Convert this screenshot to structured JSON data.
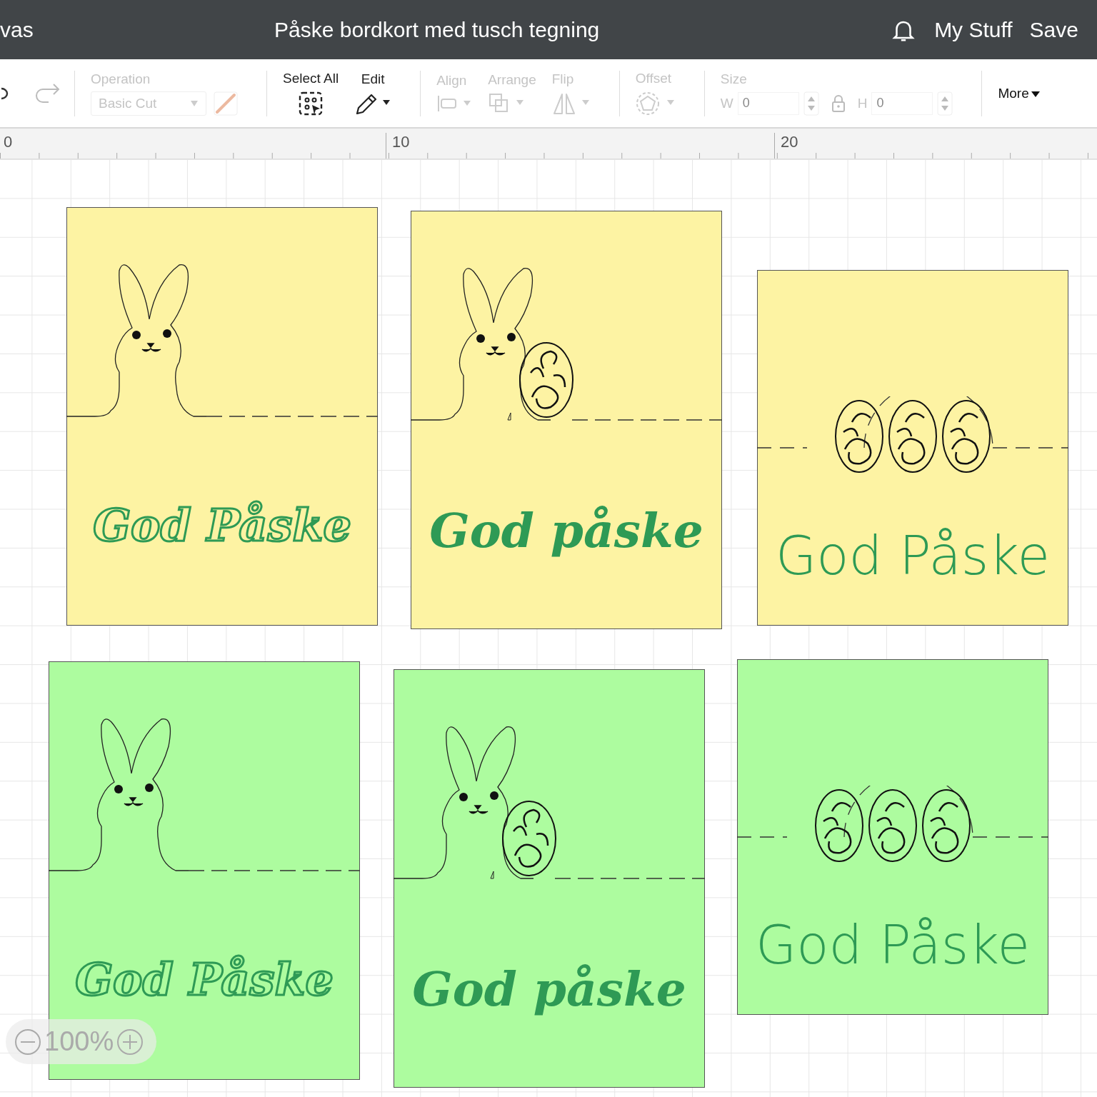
{
  "top_bar": {
    "left_text": "vas",
    "title": "Påske bordkort med tusch tegning",
    "links": [
      "My Stuff",
      "Save"
    ]
  },
  "toolbar": {
    "groups": [
      {
        "kind": "operation",
        "label": "Operation",
        "value": "Basic Cut",
        "disabled": true
      },
      {
        "kind": "select_all",
        "label": "Select All",
        "disabled": false
      },
      {
        "kind": "edit",
        "label": "Edit",
        "disabled": false
      },
      {
        "kind": "align",
        "label": "Align",
        "disabled": true
      },
      {
        "kind": "arrange",
        "label": "Arrange",
        "disabled": true
      },
      {
        "kind": "flip",
        "label": "Flip",
        "disabled": true
      },
      {
        "kind": "offset",
        "label": "Offset",
        "disabled": true
      },
      {
        "kind": "size",
        "label": "Size",
        "w_label": "W",
        "w_value": "0",
        "h_label": "H",
        "h_value": "0",
        "disabled": true
      },
      {
        "kind": "more",
        "label": "More",
        "disabled": false
      }
    ]
  },
  "ruler": {
    "labels": [
      "0",
      "10",
      "20"
    ]
  },
  "cards": [
    {
      "color": "#fdf3a3",
      "kind": "bunny",
      "greeting": "God Påske"
    },
    {
      "color": "#fdf3a3",
      "kind": "bunny_egg",
      "greeting": "God påske"
    },
    {
      "color": "#fdf3a3",
      "kind": "eggs",
      "greeting": "God Påske"
    },
    {
      "color": "#adfc9f",
      "kind": "bunny",
      "greeting": "God Påske"
    },
    {
      "color": "#adfc9f",
      "kind": "bunny_egg",
      "greeting": "God påske"
    },
    {
      "color": "#adfc9f",
      "kind": "eggs",
      "greeting": "God Påske"
    }
  ],
  "zoom": {
    "value": "100%"
  }
}
